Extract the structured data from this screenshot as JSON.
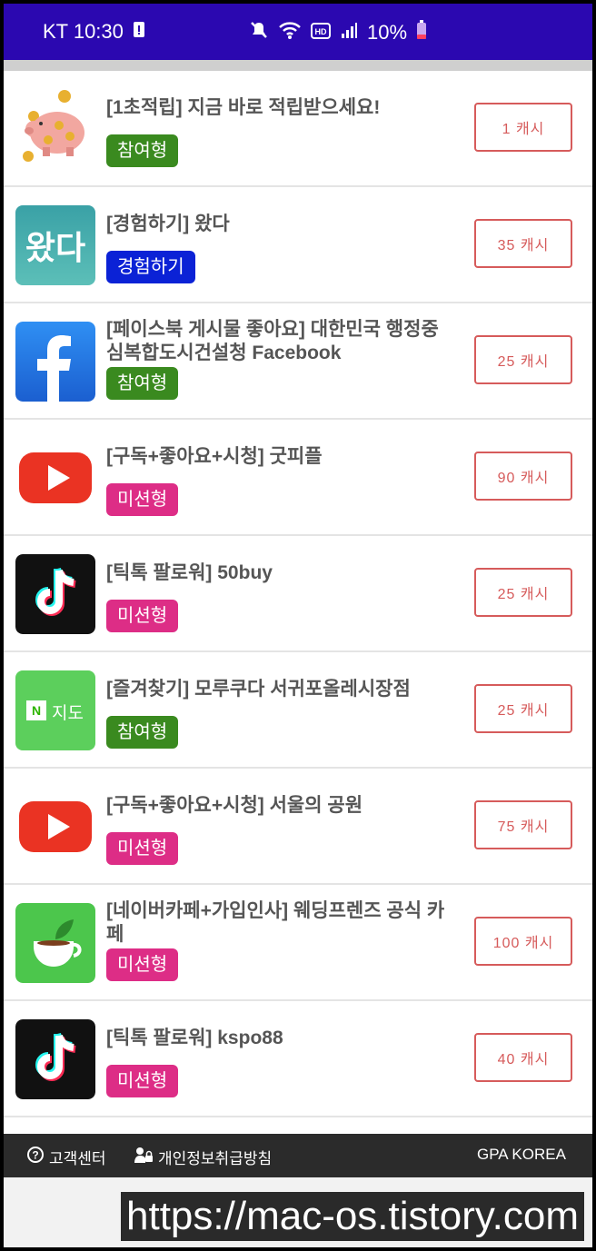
{
  "status_bar": {
    "carrier_time": "KT 10:30",
    "battery": "10%"
  },
  "offers": [
    {
      "title": "[1초적립] 지금 바로 적립받으세요!",
      "tag": "참여형",
      "tag_color": "#3a8a1f",
      "cash": "1 캐시",
      "icon": "piggy-bank-icon"
    },
    {
      "title": "[경험하기] 왔다",
      "tag": "경험하기",
      "tag_color": "#0b22d6",
      "cash": "35 캐시",
      "icon": "wassda-app-icon",
      "icon_text": "왔다"
    },
    {
      "title": "[페이스북 게시물 좋아요] 대한민국 행정중심복합도시건설청 Facebook",
      "tag": "참여형",
      "tag_color": "#3a8a1f",
      "cash": "25 캐시",
      "icon": "facebook-icon"
    },
    {
      "title": "[구독+좋아요+시청] 굿피플",
      "tag": "미션형",
      "tag_color": "#dd2d86",
      "cash": "90 캐시",
      "icon": "youtube-icon"
    },
    {
      "title": "[틱톡 팔로워] 50buy",
      "tag": "미션형",
      "tag_color": "#dd2d86",
      "cash": "25 캐시",
      "icon": "tiktok-icon"
    },
    {
      "title": "[즐겨찾기] 모루쿠다 서귀포올레시장점",
      "tag": "참여형",
      "tag_color": "#3a8a1f",
      "cash": "25 캐시",
      "icon": "naver-map-icon",
      "icon_text": "지도"
    },
    {
      "title": "[구독+좋아요+시청] 서울의 공원",
      "tag": "미션형",
      "tag_color": "#dd2d86",
      "cash": "75 캐시",
      "icon": "youtube-icon"
    },
    {
      "title": "[네이버카페+가입인사] 웨딩프렌즈 공식 카페",
      "tag": "미션형",
      "tag_color": "#dd2d86",
      "cash": "100 캐시",
      "icon": "naver-cafe-icon"
    },
    {
      "title": "[틱톡 팔로워] kspo88",
      "tag": "미션형",
      "tag_color": "#dd2d86",
      "cash": "40 캐시",
      "icon": "tiktok-icon"
    }
  ],
  "footer": {
    "support": "고객센터",
    "privacy": "개인정보취급방침",
    "company": "GPA KOREA"
  },
  "watermark": "https://mac-os.tistory.com"
}
